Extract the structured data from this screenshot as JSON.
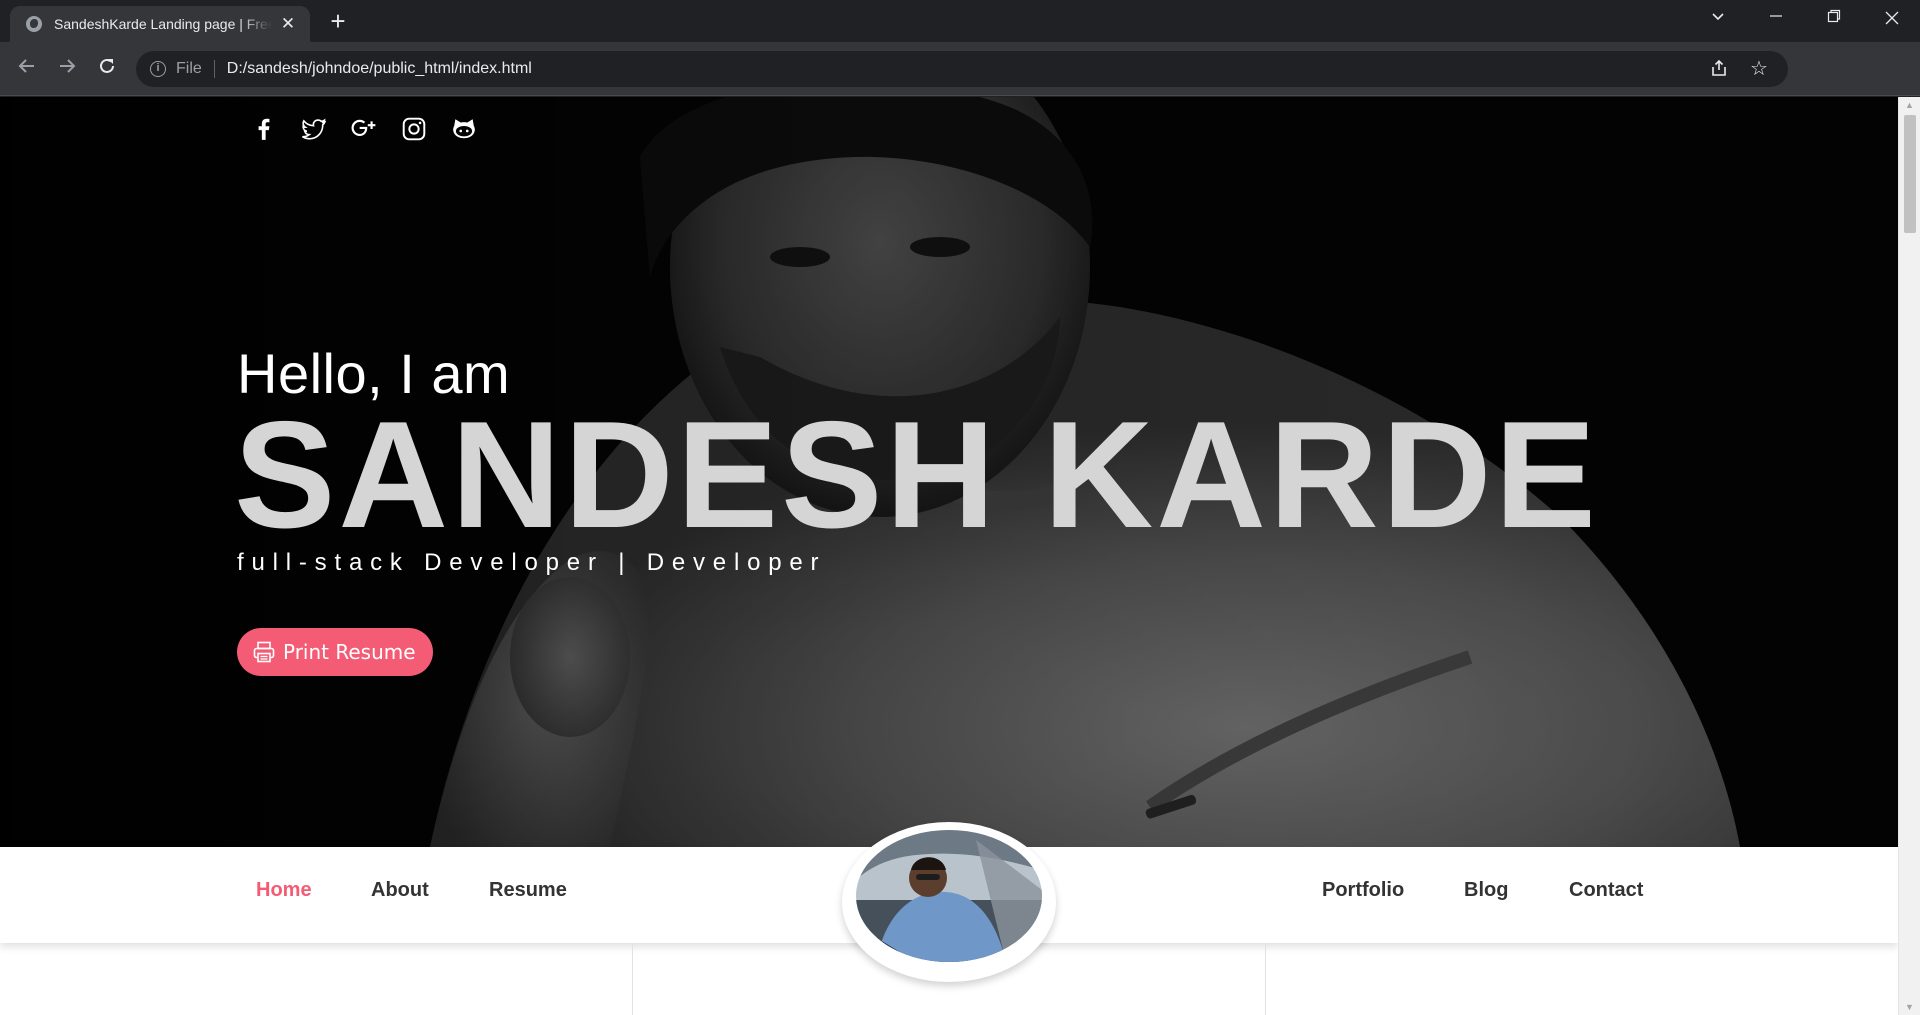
{
  "browser": {
    "tab_title": "SandeshKarde Landing page | Free Resume Template",
    "tab_close": "✕",
    "new_tab": "+",
    "omnibox_scheme": "File",
    "url": "D:/sandesh/johndoe/public_html/index.html",
    "icons": [
      "back-icon",
      "forward-icon",
      "reload-icon",
      "info-icon",
      "share-icon",
      "star-icon",
      "side-panel-icon",
      "profile-avatar",
      "menu-icon",
      "tab-search-icon",
      "minimize-icon",
      "restore-icon",
      "close-icon"
    ]
  },
  "hero": {
    "social_icons": [
      "facebook-icon",
      "twitter-icon",
      "google-plus-icon",
      "instagram-icon",
      "github-icon"
    ],
    "greeting": "Hello, I am",
    "name": "SANDESH KARDE",
    "tagline": "full-stack Developer | Developer",
    "print_button_label": "Print Resume",
    "accent_color": "#f35c74"
  },
  "navbar": {
    "left": [
      "Home",
      "About",
      "Resume"
    ],
    "right": [
      "Portfolio",
      "Blog",
      "Contact"
    ],
    "active": "Home"
  }
}
